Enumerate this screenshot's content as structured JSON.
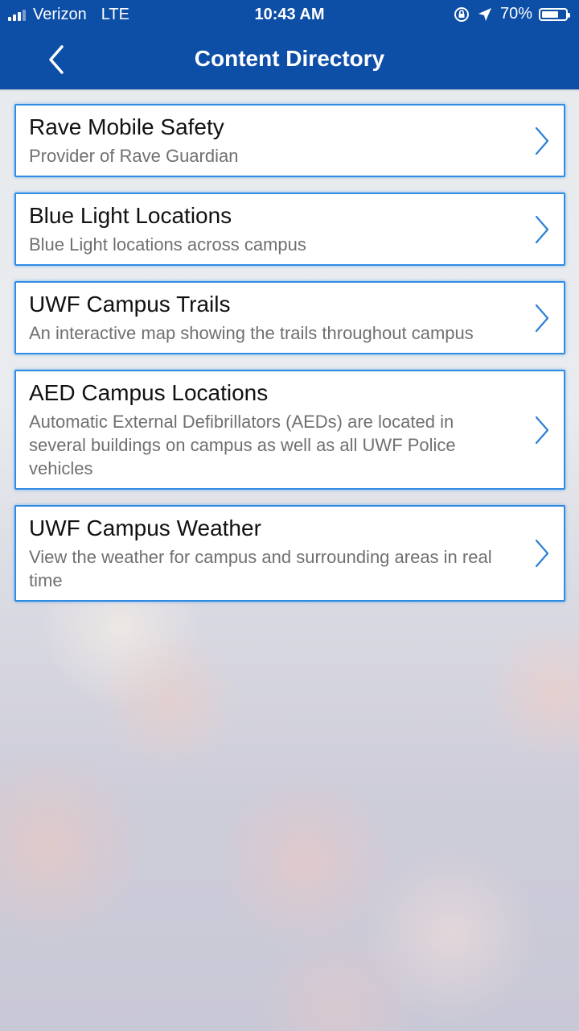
{
  "status_bar": {
    "carrier": "Verizon",
    "network": "LTE",
    "time": "10:43 AM",
    "battery": "70%",
    "battery_level": 0.7
  },
  "nav": {
    "title": "Content Directory",
    "back_icon": "chevron-left-icon"
  },
  "items": [
    {
      "title": "Rave Mobile Safety",
      "description": "Provider of Rave Guardian"
    },
    {
      "title": "Blue Light Locations",
      "description": "Blue Light locations across campus"
    },
    {
      "title": "UWF Campus Trails",
      "description": "An interactive map showing the trails throughout campus"
    },
    {
      "title": "AED Campus Locations",
      "description": "Automatic External Defibrillators (AEDs) are located in several buildings on campus as well as all UWF Police vehicles"
    },
    {
      "title": "UWF Campus Weather",
      "description": "View the weather for campus and surrounding areas in real time"
    }
  ],
  "colors": {
    "header": "#0d4ea6",
    "card_border": "#2f8be3",
    "chevron": "#2a7fd4"
  }
}
